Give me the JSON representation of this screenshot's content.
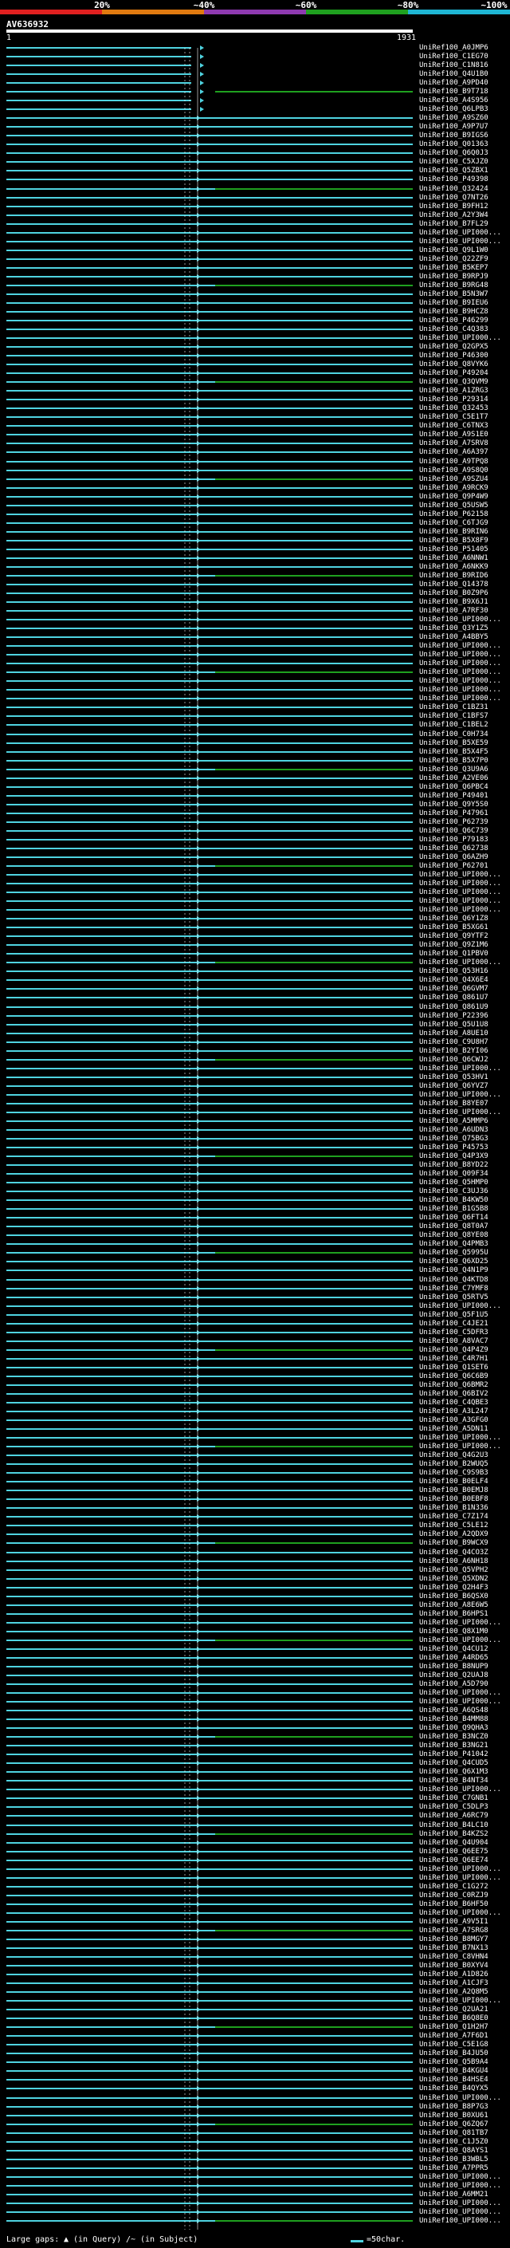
{
  "scale": {
    "labels": [
      "20%",
      "~40%",
      "~60%",
      "~80%",
      "~100%"
    ],
    "colors": [
      "#e02020",
      "#e07a10",
      "#8e3ab0",
      "#1fa01f",
      "#1fb6d4"
    ]
  },
  "query": {
    "id": "AV636932",
    "start": "1",
    "end": "1931"
  },
  "colors": {
    "hit": "#4fd3e0",
    "hit_secondary": "#1fa01f",
    "connector": "#ffffff"
  },
  "hits": [
    "UniRef100_A0JMP6",
    "UniRef100_C1EG70",
    "UniRef100_C1N816",
    "UniRef100_Q4U1B0",
    "UniRef100_A9PD40",
    "UniRef100_B9T718",
    "UniRef100_A4S956",
    "UniRef100_Q6LPB3",
    "UniRef100_A9SZ60",
    "UniRef100_A9P7U7",
    "UniRef100_B9IGS6",
    "UniRef100_Q01363",
    "UniRef100_Q6Q0J3",
    "UniRef100_C5XJZ0",
    "UniRef100_Q5ZBX1",
    "UniRef100_P49398",
    "UniRef100_Q32424",
    "UniRef100_Q7NT26",
    "UniRef100_B9FH12",
    "UniRef100_A2Y3W4",
    "UniRef100_B7FL29",
    "UniRef100_UPI000...",
    "UniRef100_UPI000...",
    "UniRef100_Q9L1W0",
    "UniRef100_Q22ZF9",
    "UniRef100_B5KEP7",
    "UniRef100_B9RPJ9",
    "UniRef100_B9RG48",
    "UniRef100_B5N3W7",
    "UniRef100_B9IEU6",
    "UniRef100_B9HCZ8",
    "UniRef100_P46299",
    "UniRef100_C4Q383",
    "UniRef100_UPI000...",
    "UniRef100_Q2GPX5",
    "UniRef100_P46300",
    "UniRef100_Q8VYK6",
    "UniRef100_P49204",
    "UniRef100_Q3QVM9",
    "UniRef100_A1ZRG3",
    "UniRef100_P29314",
    "UniRef100_Q32453",
    "UniRef100_C5E1T7",
    "UniRef100_C6TNX3",
    "UniRef100_A9S1E0",
    "UniRef100_A7SRV8",
    "UniRef100_A6A397",
    "UniRef100_A9TPQ8",
    "UniRef100_A9S8Q0",
    "UniRef100_A9SZU4",
    "UniRef100_A9RCK9",
    "UniRef100_Q9P4W9",
    "UniRef100_Q5USW5",
    "UniRef100_P62158",
    "UniRef100_C6TJG9",
    "UniRef100_B9RIN6",
    "UniRef100_B5X8F9",
    "UniRef100_P51405",
    "UniRef100_A6NNW1",
    "UniRef100_A6NKK9",
    "UniRef100_B9RID6",
    "UniRef100_Q14378",
    "UniRef100_B0Z9P6",
    "UniRef100_B9X6J1",
    "UniRef100_A7RF30",
    "UniRef100_UPI000...",
    "UniRef100_Q3Y1Z5",
    "UniRef100_A4BBY5",
    "UniRef100_UPI000...",
    "UniRef100_UPI000...",
    "UniRef100_UPI000...",
    "UniRef100_UPI000...",
    "UniRef100_UPI000...",
    "UniRef100_UPI000...",
    "UniRef100_UPI000...",
    "UniRef100_C1BZ31",
    "UniRef100_C1BFS7",
    "UniRef100_C1BEL2",
    "UniRef100_C0H734",
    "UniRef100_B5XE59",
    "UniRef100_B5X4F5",
    "UniRef100_B5X7P0",
    "UniRef100_Q3U9A6",
    "UniRef100_A2VE06",
    "UniRef100_Q6PBC4",
    "UniRef100_P49401",
    "UniRef100_Q9Y5S0",
    "UniRef100_P47961",
    "UniRef100_P62739",
    "UniRef100_Q6C739",
    "UniRef100_P79183",
    "UniRef100_Q62738",
    "UniRef100_Q6AZH9",
    "UniRef100_P62701",
    "UniRef100_UPI000...",
    "UniRef100_UPI000...",
    "UniRef100_UPI000...",
    "UniRef100_UPI000...",
    "UniRef100_UPI000...",
    "UniRef100_Q6Y1Z8",
    "UniRef100_B5XG61",
    "UniRef100_Q9YTF2",
    "UniRef100_Q9Z1M6",
    "UniRef100_Q1PBV0",
    "UniRef100_UPI000...",
    "UniRef100_Q53H16",
    "UniRef100_Q4X6E4",
    "UniRef100_Q6GVM7",
    "UniRef100_Q861U7",
    "UniRef100_Q861U9",
    "UniRef100_P22396",
    "UniRef100_Q5U1U8",
    "UniRef100_A8UE10",
    "UniRef100_C9U8H7",
    "UniRef100_B2YI06",
    "UniRef100_Q6CWJ2",
    "UniRef100_UPI000...",
    "UniRef100_Q53HV1",
    "UniRef100_Q6YVZ7",
    "UniRef100_UPI000...",
    "UniRef100_B8YE07",
    "UniRef100_UPI000...",
    "UniRef100_A5MMP6",
    "UniRef100_A6UDN3",
    "UniRef100_Q75BG3",
    "UniRef100_P45753",
    "UniRef100_Q4P3X9",
    "UniRef100_B8YD22",
    "UniRef100_Q09F34",
    "UniRef100_Q5HMP0",
    "UniRef100_C3UJ36",
    "UniRef100_B4KW50",
    "UniRef100_B1G5B8",
    "UniRef100_Q6FT14",
    "UniRef100_Q8T0A7",
    "UniRef100_Q8YE08",
    "UniRef100_Q4PMB3",
    "UniRef100_Q5995U",
    "UniRef100_Q6XD25",
    "UniRef100_Q4N1P9",
    "UniRef100_Q4KTD8",
    "UniRef100_C7YMF8",
    "UniRef100_Q5RTV5",
    "UniRef100_UPI000...",
    "UniRef100_Q5F1U5",
    "UniRef100_C4JE21",
    "UniRef100_C5DFR3",
    "UniRef100_A8VAC7",
    "UniRef100_Q4P4Z9",
    "UniRef100_C4R7H1",
    "UniRef100_Q1SET6",
    "UniRef100_Q6C6B9",
    "UniRef100_Q6BMR2",
    "UniRef100_Q6BIV2",
    "UniRef100_C4QBE3",
    "UniRef100_A3L247",
    "UniRef100_A3GFG0",
    "UniRef100_A5DN11",
    "UniRef100_UPI000...",
    "UniRef100_UPI000...",
    "UniRef100_Q4G2U3",
    "UniRef100_B2WUQ5",
    "UniRef100_C9S9B3",
    "UniRef100_B0ELF4",
    "UniRef100_B0EMJ8",
    "UniRef100_B0EBF8",
    "UniRef100_B1N336",
    "UniRef100_C7Z174",
    "UniRef100_C5LE12",
    "UniRef100_A2QDX9",
    "UniRef100_B9WCX9",
    "UniRef100_Q4CO3Z",
    "UniRef100_A6NH18",
    "UniRef100_Q5VPH2",
    "UniRef100_Q5XDN2",
    "UniRef100_Q2H4F3",
    "UniRef100_B6QSX0",
    "UniRef100_A8E6W5",
    "UniRef100_B6HPS1",
    "UniRef100_UPI000...",
    "UniRef100_Q8X1M0",
    "UniRef100_UPI000...",
    "UniRef100_Q4CU12",
    "UniRef100_A4RD65",
    "UniRef100_B8NUP9",
    "UniRef100_Q2UAJ8",
    "UniRef100_A5D790",
    "UniRef100_UPI000...",
    "UniRef100_UPI000...",
    "UniRef100_A6QS48",
    "UniRef100_B4MM88",
    "UniRef100_Q9QHA3",
    "UniRef100_B3NCZ0",
    "UniRef100_B3NG21",
    "UniRef100_P41042",
    "UniRef100_Q4CUD5",
    "UniRef100_Q6X1M3",
    "UniRef100_B4NT34",
    "UniRef100_UPI000...",
    "UniRef100_C7GNB1",
    "UniRef100_C5DLP3",
    "UniRef100_A6RC79",
    "UniRef100_B4LC10",
    "UniRef100_B4KZS2",
    "UniRef100_Q4U904",
    "UniRef100_Q6EE75",
    "UniRef100_Q6EE74",
    "UniRef100_UPI000...",
    "UniRef100_UPI000...",
    "UniRef100_C1G272",
    "UniRef100_C0RZJ9",
    "UniRef100_B6HF50",
    "UniRef100_UPI000...",
    "UniRef100_A9V5I1",
    "UniRef100_A7SRG8",
    "UniRef100_B8MGY7",
    "UniRef100_B7NX13",
    "UniRef100_C8VHN4",
    "UniRef100_B0XYV4",
    "UniRef100_A1D826",
    "UniRef100_A1CJF3",
    "UniRef100_A2Q8M5",
    "UniRef100_UPI000...",
    "UniRef100_Q2UA21",
    "UniRef100_B6Q8E0",
    "UniRef100_Q1H2H7",
    "UniRef100_A7F6D1",
    "UniRef100_C5E1G8",
    "UniRef100_B4JU50",
    "UniRef100_Q5B9A4",
    "UniRef100_B4KGU4",
    "UniRef100_B4HSE4",
    "UniRef100_B4QYX5",
    "UniRef100_UPI000...",
    "UniRef100_B8P7G3",
    "UniRef100_B0XU61",
    "UniRef100_Q6ZQ67",
    "UniRef100_Q81TB7",
    "UniRef100_C1J5Z0",
    "UniRef100_Q8AYS1",
    "UniRef100_B3WBL5",
    "UniRef100_A7PPR5",
    "UniRef100_UPI000...",
    "UniRef100_UPI000...",
    "UniRef100_A6MM21",
    "UniRef100_UPI000...",
    "UniRef100_UPI000...",
    "UniRef100_UPI000..."
  ],
  "legend": {
    "gaps_label": "Large gaps:",
    "query_gap": "(in Query)",
    "subject_gap": "(in Subject)",
    "scale_label": "=50char."
  }
}
